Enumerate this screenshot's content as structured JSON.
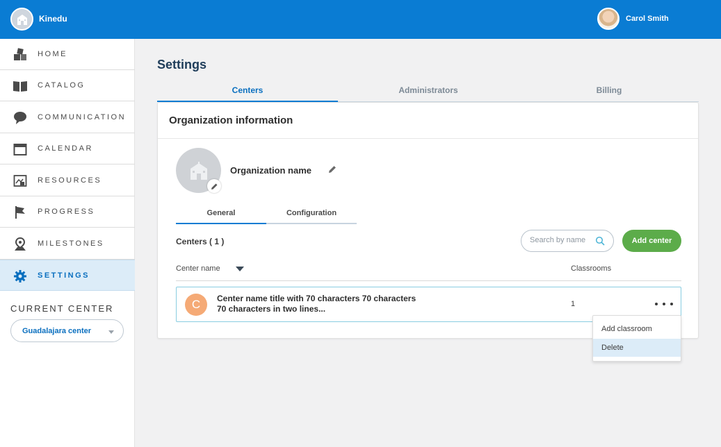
{
  "topbar": {
    "brand_name": "Kinedu",
    "user_name": "Carol Smith"
  },
  "sidebar": {
    "items": [
      {
        "label": "HOME",
        "icon": "blocks-icon"
      },
      {
        "label": "CATALOG",
        "icon": "book-icon"
      },
      {
        "label": "COMMUNICATION",
        "icon": "chat-bubble-icon"
      },
      {
        "label": "CALENDAR",
        "icon": "calendar-icon"
      },
      {
        "label": "RESOURCES",
        "icon": "resources-icon"
      },
      {
        "label": "PROGRESS",
        "icon": "flag-icon"
      },
      {
        "label": "MILESTONES",
        "icon": "map-pin-icon"
      },
      {
        "label": "SETTINGS",
        "icon": "gear-icon",
        "active": true
      }
    ],
    "current_center_label": "CURRENT CENTER",
    "current_center_value": "Guadalajara center"
  },
  "main": {
    "page_title": "Settings",
    "tabs": [
      {
        "label": "Centers",
        "active": true
      },
      {
        "label": "Administrators"
      },
      {
        "label": "Billing"
      }
    ],
    "card": {
      "title": "Organization information",
      "org_name": "Organization name",
      "subtabs": [
        {
          "label": "General",
          "active": true
        },
        {
          "label": "Configuration"
        }
      ],
      "centers_count": "Centers ( 1 )",
      "search_placeholder": "Search by name",
      "add_center_label": "Add center",
      "columns": {
        "center_name": "Center name",
        "classrooms": "Classrooms"
      },
      "rows": [
        {
          "initial": "C",
          "name": "Center name title with 70 characters 70 characters 70 characters in two lines...",
          "classrooms": "1"
        }
      ]
    },
    "row_menu": [
      {
        "label": "Add classroom"
      },
      {
        "label": "Delete",
        "hover": true
      }
    ]
  },
  "colors": {
    "topbar": "#0a7cd3",
    "accent_blue": "#0a6fbf",
    "add_button_green": "#5cac4a",
    "center_initial_orange": "#f5aa76",
    "active_nav_bg": "#dcecf8"
  }
}
